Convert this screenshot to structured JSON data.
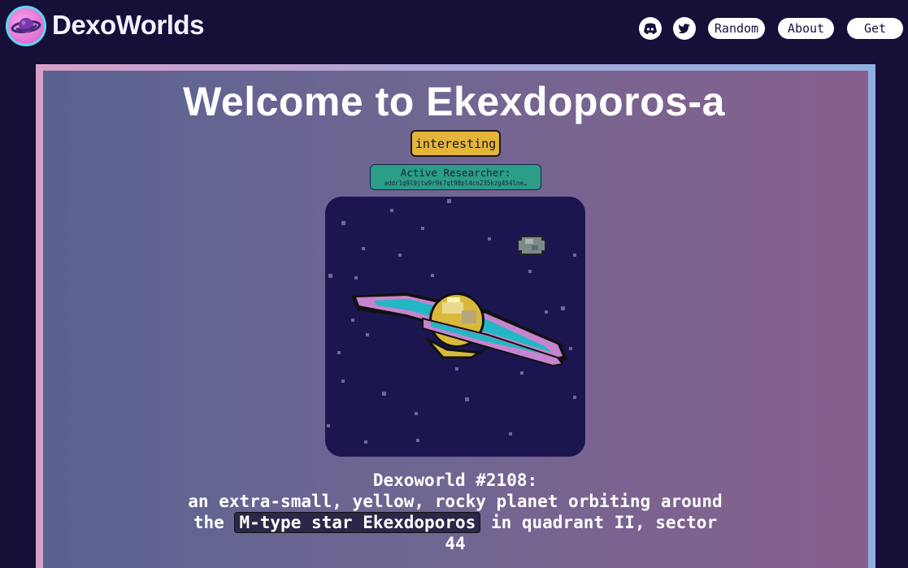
{
  "header": {
    "brand": "DexoWorlds",
    "logo_icon": "planet-logo-icon",
    "social": [
      "discord-icon",
      "twitter-icon"
    ],
    "nav": [
      {
        "label": "Random"
      },
      {
        "label": "About"
      },
      {
        "label": "Get"
      }
    ]
  },
  "world": {
    "title": "Welcome to Ekexdoporos-a",
    "tag": "interesting",
    "researcher_label": "Active Researcher:",
    "researcher_address": "addr1q9l9jtw9r9k7qt98pl4cn235kzg454lne…",
    "image_icon": "ringed-planet-pixel-art",
    "desc_line1": "Dexoworld #2108:",
    "desc_line2": "an extra-small, yellow, rocky planet orbiting around",
    "desc_the": "the",
    "desc_star": "M-type star Ekexdoporos",
    "desc_rest": "in quadrant II, sector",
    "desc_sector": "44"
  },
  "colors": {
    "background": "#160f38",
    "tag": "#e3b53a",
    "researcher": "#2c9d86",
    "planet_bg": "#1c1650",
    "logo_ring": "#5fd6f0"
  }
}
